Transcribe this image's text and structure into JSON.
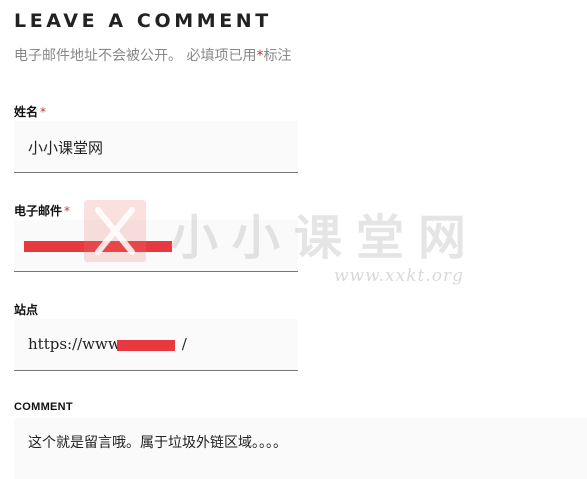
{
  "form": {
    "title": "LEAVE A COMMENT",
    "notes_text": "电子邮件地址不会被公开。 必填项已用",
    "notes_star": "*",
    "notes_suffix": "标注",
    "fields": {
      "name": {
        "label": "姓名",
        "required_mark": "*",
        "value": "小小课堂网"
      },
      "email": {
        "label": "电子邮件",
        "required_mark": "*",
        "value": ""
      },
      "url": {
        "label": "站点",
        "value_prefix": "https://www.",
        "value_suffix": "/"
      },
      "comment": {
        "label": "COMMENT",
        "value": "这个就是留言哦。属于垃圾外链区域。。。。"
      }
    },
    "colors": {
      "required": "#c0392b",
      "redaction": "#e8393e"
    }
  },
  "watermark": {
    "text": "小小课堂网",
    "url": "www.xxkt.org"
  }
}
